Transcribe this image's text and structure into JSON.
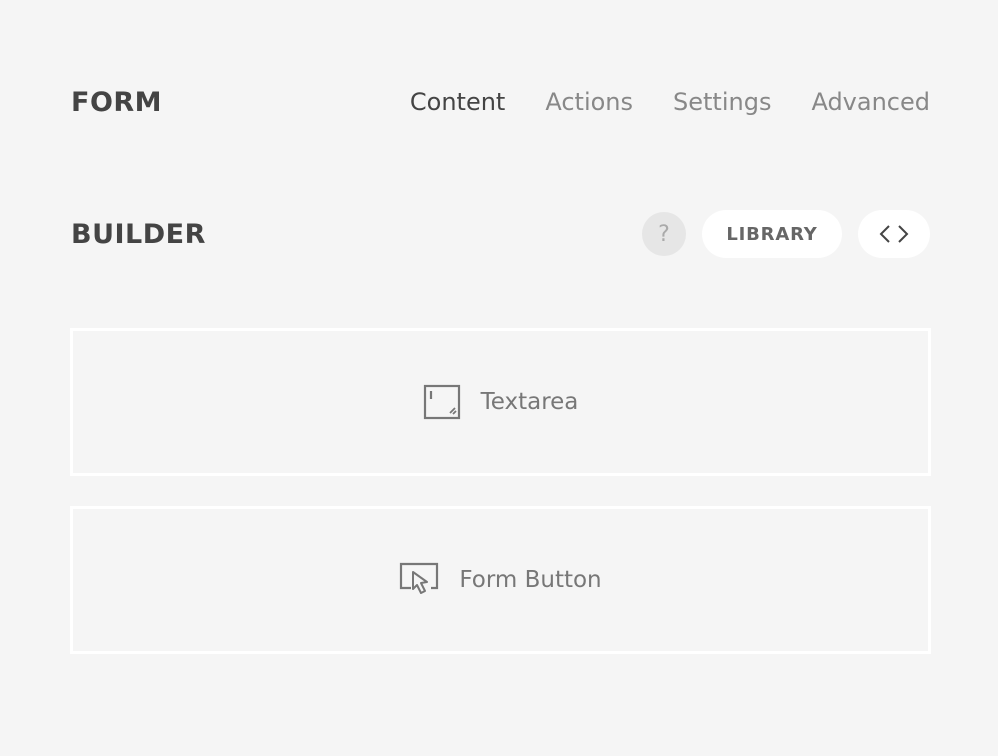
{
  "header": {
    "title": "FORM",
    "tabs": [
      {
        "label": "Content",
        "active": true
      },
      {
        "label": "Actions",
        "active": false
      },
      {
        "label": "Settings",
        "active": false
      },
      {
        "label": "Advanced",
        "active": false
      }
    ]
  },
  "builder": {
    "title": "BUILDER",
    "help_label": "?",
    "library_label": "LIBRARY",
    "code_icon": "code-brackets-icon"
  },
  "elements": [
    {
      "label": "Textarea",
      "icon": "textarea-icon"
    },
    {
      "label": "Form Button",
      "icon": "cursor-click-icon"
    }
  ],
  "colors": {
    "background": "#f5f5f5",
    "text_dark": "#444444",
    "text_muted": "#888888",
    "card_border": "#ffffff"
  }
}
